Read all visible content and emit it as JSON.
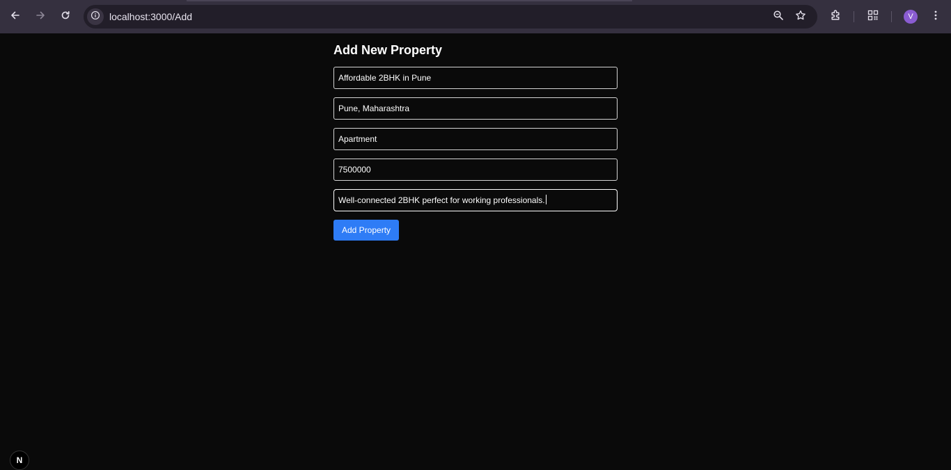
{
  "browser": {
    "url": "localhost:3000/Add",
    "profile_initial": "V",
    "icons": {
      "back": "arrow-left-icon",
      "forward": "arrow-right-icon",
      "reload": "reload-icon",
      "site_info": "info-icon",
      "zoom": "zoom-icon",
      "bookmark": "star-icon",
      "extensions": "puzzle-icon",
      "qr": "qr-code-icon",
      "menu": "kebab-menu-icon"
    }
  },
  "form": {
    "title": "Add New Property",
    "fields": {
      "title": "Affordable 2BHK in Pune",
      "location": "Pune, Maharashtra",
      "type": "Apartment",
      "price": "7500000",
      "description": "Well-connected 2BHK perfect for working professionals."
    },
    "submit_label": "Add Property"
  },
  "dev_badge": {
    "label": "N"
  },
  "colors": {
    "page_background": "#0a0a0a",
    "toolbar": "#35303f",
    "omnibox": "#221e29",
    "button_primary": "#2e7cf6",
    "avatar": "#8a5cd1"
  }
}
